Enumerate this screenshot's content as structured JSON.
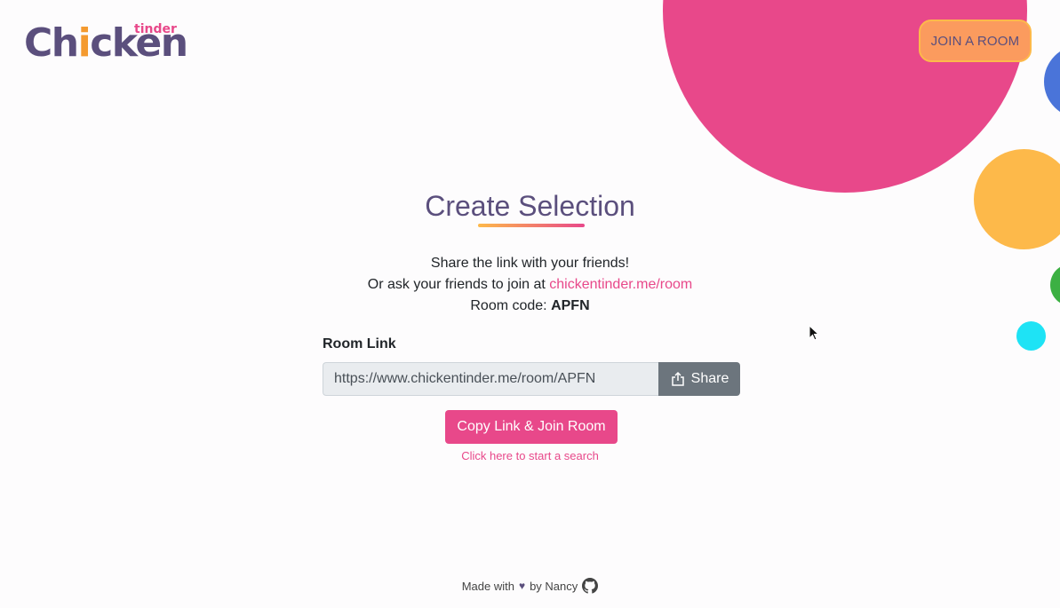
{
  "logo": {
    "word_start": "Ch",
    "word_drum": "i",
    "word_end": "cken",
    "subtitle": "tinder"
  },
  "header": {
    "join_label": "JOIN A ROOM"
  },
  "main": {
    "title": "Create Selection",
    "share_text": "Share the link with your friends!",
    "ask_text": "Or ask your friends to join at ",
    "ask_link": "chickentinder.me/room",
    "code_label": "Room code: ",
    "code_value": "APFN",
    "room_link_label": "Room Link",
    "room_link_value": "https://www.chickentinder.me/room/APFN",
    "share_label": "Share",
    "copy_label": "Copy Link & Join Room",
    "start_label": "Click here to start a search"
  },
  "footer": {
    "made_with": "Made with",
    "heart": "♥",
    "by": "by Nancy"
  },
  "colors": {
    "pink": "#e8488a",
    "orange": "#fdb94a",
    "blue": "#4a74d9",
    "green": "#3cb043",
    "cyan": "#1ee3f5",
    "brand_purple": "#5b4f7d"
  },
  "icons": {
    "share": "share-icon",
    "github": "github-icon",
    "heart": "heart-icon"
  }
}
